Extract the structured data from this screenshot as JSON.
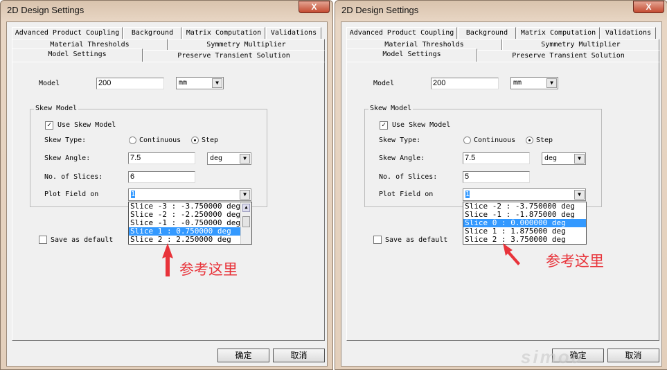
{
  "dialogs": [
    {
      "title": "2D Design Settings",
      "close": "X",
      "tabs": {
        "row1": [
          "Advanced Product Coupling",
          "Background",
          "Matrix Computation",
          "Validations"
        ],
        "row2": [
          "Material Thresholds",
          "Symmetry Multiplier"
        ],
        "row3": [
          "Model Settings",
          "Preserve Transient Solution"
        ]
      },
      "model_label": "Model",
      "model_value": "200",
      "model_unit": "mm",
      "group_label": "Skew Model",
      "use_skew": "Use Skew Model",
      "use_skew_checked": true,
      "skew_type_label": "Skew Type:",
      "continuous": "Continuous",
      "step": "Step",
      "skew_type": "Step",
      "skew_angle_label": "Skew Angle:",
      "skew_angle": "7.5",
      "angle_unit": "deg",
      "slices_label": "No. of Slices:",
      "slices": "6",
      "plot_label": "Plot Field on",
      "plot_value": "1",
      "options": [
        "Slice -3 : -3.750000 deg",
        "Slice -2 : -2.250000 deg",
        "Slice -1 : -0.750000 deg",
        "Slice 1 : 0.750000 deg",
        "Slice 2 : 2.250000 deg"
      ],
      "selected_index": 3,
      "has_scrollbar": true,
      "save_default": "Save as default",
      "ok": "确定",
      "cancel": "取消",
      "annotation": "参考这里"
    },
    {
      "title": "2D Design Settings",
      "close": "X",
      "tabs": {
        "row1": [
          "Advanced Product Coupling",
          "Background",
          "Matrix Computation",
          "Validations"
        ],
        "row2": [
          "Material Thresholds",
          "Symmetry Multiplier"
        ],
        "row3": [
          "Model Settings",
          "Preserve Transient Solution"
        ]
      },
      "model_label": "Model",
      "model_value": "200",
      "model_unit": "mm",
      "group_label": "Skew Model",
      "use_skew": "Use Skew Model",
      "use_skew_checked": true,
      "skew_type_label": "Skew Type:",
      "continuous": "Continuous",
      "step": "Step",
      "skew_type": "Step",
      "skew_angle_label": "Skew Angle:",
      "skew_angle": "7.5",
      "angle_unit": "deg",
      "slices_label": "No. of Slices:",
      "slices": "5",
      "plot_label": "Plot Field on",
      "plot_value": "1",
      "options": [
        "Slice -2 : -3.750000 deg",
        "Slice -1 : -1.875000 deg",
        "Slice 0 : 0.000000 deg",
        "Slice 1 : 1.875000 deg",
        "Slice 2 : 3.750000 deg"
      ],
      "selected_index": 2,
      "has_scrollbar": false,
      "save_default": "Save as default",
      "ok": "确定",
      "cancel": "取消",
      "annotation": "参考这里"
    }
  ],
  "watermark": "simol 西莫",
  "colors": {
    "annotation": "#e8333a",
    "highlight": "#3399ff"
  }
}
